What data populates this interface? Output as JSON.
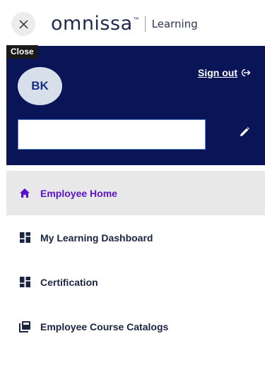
{
  "header": {
    "close_tooltip": "Close",
    "logo_word": "omnissa",
    "logo_tm": "™",
    "logo_sub": "Learning"
  },
  "profile": {
    "initials": "BK",
    "signout_label": "Sign out",
    "name_value": ""
  },
  "nav": {
    "items": [
      {
        "label": "Employee Home",
        "icon": "home-icon",
        "active": true
      },
      {
        "label": "My Learning Dashboard",
        "icon": "dashboard-icon",
        "active": false
      },
      {
        "label": "Certification",
        "icon": "dashboard-icon",
        "active": false
      },
      {
        "label": "Employee Course Catalogs",
        "icon": "catalog-icon",
        "active": false
      }
    ]
  },
  "colors": {
    "profile_bg": "#0a1558",
    "active_accent": "#5a12c9",
    "active_bg": "#e8e8e8"
  }
}
